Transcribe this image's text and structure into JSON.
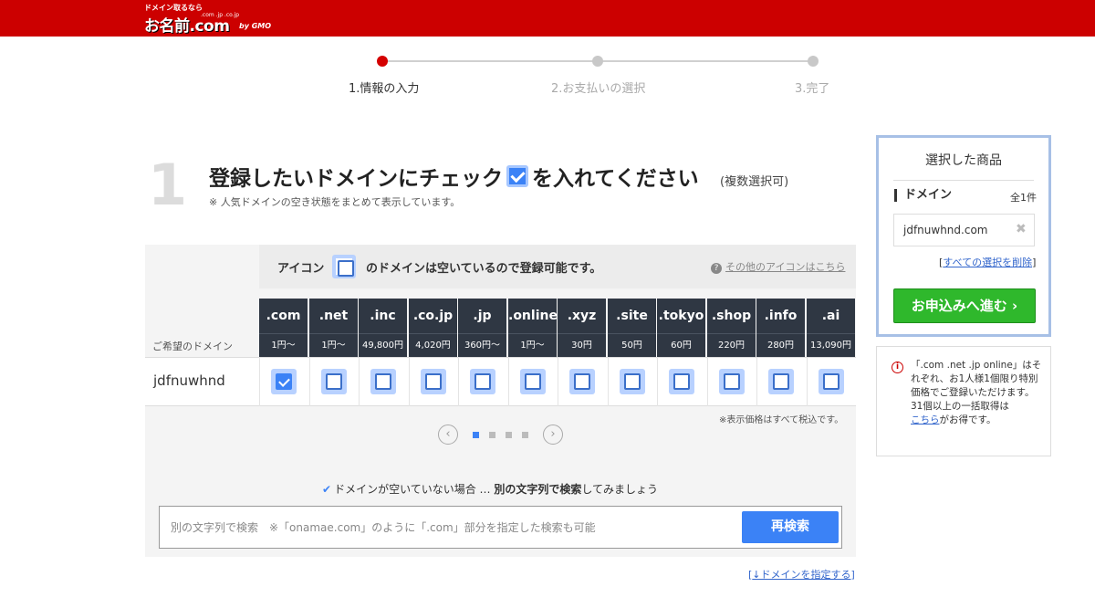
{
  "header": {
    "tagline": "ドメイン取るなら",
    "tlds": ".com .jp .co.jp",
    "logo_text": "お名前.com",
    "by": "by GMO"
  },
  "steps": [
    {
      "label": "1.情報の入力",
      "active": true
    },
    {
      "label": "2.お支払いの選択",
      "active": false
    },
    {
      "label": "3.完了",
      "active": false
    }
  ],
  "section": {
    "number": "1",
    "title_part1": "登録したいドメインにチェック",
    "title_part2": "を入れてください",
    "multi": "(複数選択可)",
    "note": "※ 人気ドメインの空き状態をまとめて表示しています。"
  },
  "legend": {
    "prefix": "アイコン",
    "suffix": "のドメインは空いているので登録可能です。",
    "help": "その他のアイコンはこちら"
  },
  "table": {
    "desired_label": "ご希望のドメイン",
    "domain": "jdfnuwhnd",
    "tlds": [
      {
        "tld": ".com",
        "price": "1円〜",
        "checked": true
      },
      {
        "tld": ".net",
        "price": "1円〜",
        "checked": false
      },
      {
        "tld": ".inc",
        "price": "49,800円",
        "checked": false
      },
      {
        "tld": ".co.jp",
        "price": "4,020円",
        "checked": false
      },
      {
        "tld": ".jp",
        "price": "360円〜",
        "checked": false
      },
      {
        "tld": ".online",
        "price": "1円〜",
        "checked": false
      },
      {
        "tld": ".xyz",
        "price": "30円",
        "checked": false
      },
      {
        "tld": ".site",
        "price": "50円",
        "checked": false
      },
      {
        "tld": ".tokyo",
        "price": "60円",
        "checked": false
      },
      {
        "tld": ".shop",
        "price": "220円",
        "checked": false
      },
      {
        "tld": ".info",
        "price": "280円",
        "checked": false
      },
      {
        "tld": ".ai",
        "price": "13,090円",
        "checked": false
      }
    ],
    "tax_note": "※表示価格はすべて税込です。"
  },
  "pager": {
    "prev": "‹",
    "next": "›",
    "pages": 4,
    "active_page": 1
  },
  "search": {
    "hint_pre": "ドメインが空いていない場合 … ",
    "hint_bold": "別の文字列で検索",
    "hint_post": "してみましょう",
    "placeholder": "別の文字列で検索　※「onamae.com」のように「.com」部分を指定した検索も可能",
    "button": "再検索"
  },
  "specify_link": "↓ドメインを指定する",
  "cart": {
    "title": "選択した商品",
    "label": "ドメイン",
    "count": "全1件",
    "item": "jdfnuwhnd.com",
    "clear_link": "すべての選択を削除",
    "order_button": "お申込みへ進む ›"
  },
  "promo": {
    "text": "「.com .net .jp online」はそれぞれ、お1人様1個限り特別価格でご登録いただけます。",
    "text2": "31個以上の一括取得は",
    "link": "こちら",
    "text3": "がお得です。"
  }
}
